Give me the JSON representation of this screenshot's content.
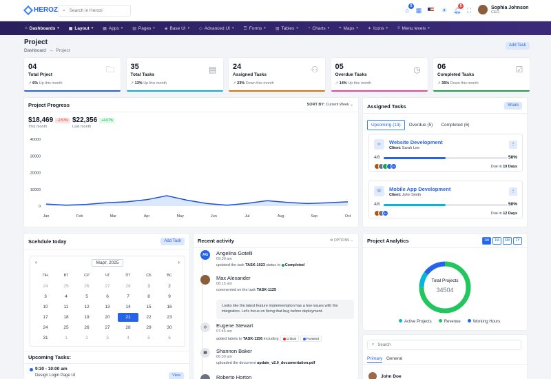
{
  "app": {
    "name": "Herozi"
  },
  "topbar": {
    "search_placeholder": "Search in Herozi",
    "cart_count": "5",
    "notif_count": "5",
    "user": {
      "name": "Sophia Johnson",
      "role": "CEO"
    }
  },
  "nav": [
    {
      "label": "Dashboards",
      "icon": "home-icon",
      "active": true
    },
    {
      "label": "Layout",
      "icon": "layout-icon",
      "active": true
    },
    {
      "label": "Apps",
      "icon": "grid-icon"
    },
    {
      "label": "Pages",
      "icon": "pages-icon"
    },
    {
      "label": "Base UI",
      "icon": "base-ui-icon"
    },
    {
      "label": "Advanced UI",
      "icon": "advanced-ui-icon"
    },
    {
      "label": "Forms",
      "icon": "forms-icon"
    },
    {
      "label": "Tables",
      "icon": "tables-icon"
    },
    {
      "label": "Charts",
      "icon": "charts-icon"
    },
    {
      "label": "Maps",
      "icon": "maps-icon"
    },
    {
      "label": "Icons",
      "icon": "icons-icon"
    },
    {
      "label": "Menu levels",
      "icon": "menu-icon"
    }
  ],
  "page": {
    "title": "Project",
    "crumb_root": "Dashboard",
    "crumb_current": "Project",
    "add_task": "Add Task"
  },
  "stats": [
    {
      "num": "04",
      "label": "Total Prject",
      "pct": "6%",
      "trend": "Up this month",
      "icon": "folder-icon",
      "color": "#2563eb"
    },
    {
      "num": "35",
      "label": "Total Tasks",
      "pct": "13%",
      "trend": "Up this month",
      "icon": "tasks-icon",
      "color": "#06b6d4"
    },
    {
      "num": "24",
      "label": "Assigned Tasks",
      "pct": "23%",
      "trend": "Down this month",
      "icon": "user-add-icon",
      "color": "#d97706"
    },
    {
      "num": "05",
      "label": "Overdue Tasks",
      "pct": "14%",
      "trend": "Up this month",
      "icon": "clock-icon",
      "color": "#ec4899"
    },
    {
      "num": "06",
      "label": "Completed Tasks",
      "pct": "35%",
      "trend": "Down this month",
      "icon": "check-icon",
      "color": "#16a34a"
    }
  ],
  "progress": {
    "title": "Project Progress",
    "sort_label": "SORT BY:",
    "sort_value": "Current Week",
    "v1": "$18,469",
    "v1_tag": "-2.57%",
    "v1_label": "This month",
    "v2": "$22,356",
    "v2_tag": "+4.67%",
    "v2_label": "Last month"
  },
  "chart_data": {
    "type": "area",
    "categories": [
      "Jan",
      "Feb",
      "Mar",
      "Apr",
      "May",
      "Jun",
      "Jul",
      "Aug",
      "Sep",
      "Oct"
    ],
    "series": [
      {
        "values": [
          1200,
          500,
          1000,
          2000,
          2500,
          3800,
          6200,
          3500,
          1500,
          500,
          1600,
          3200,
          2200,
          1500,
          2000,
          2500
        ]
      }
    ],
    "yticks": [
      "40000",
      "30000",
      "20000",
      "10000",
      "0"
    ],
    "ylim": [
      0,
      40000
    ]
  },
  "assigned": {
    "title": "Assigned Tasks",
    "share": "Share",
    "tabs": [
      "Upcoming (13)",
      "Overdue (5)",
      "Completed (6)"
    ],
    "tasks": [
      {
        "name": "Website Development",
        "client_label": "Client:",
        "client": "Sarah Lee",
        "frac": "4/8",
        "pct": "50%",
        "progress": 0.5,
        "color": "#2563eb",
        "due_label": "Due in",
        "due": "10 Days",
        "more": "8+",
        "icon": "code-icon"
      },
      {
        "name": "Mobile App Development",
        "client_label": "Client:",
        "client": "John Smith",
        "frac": "4/8",
        "pct": "50%",
        "progress": 0.5,
        "color": "#06b6d4",
        "due_label": "Due in",
        "due": "12 Days",
        "more": "8+",
        "icon": "phone-icon"
      }
    ]
  },
  "schedule": {
    "title": "Scehdule today",
    "add": "Add Task",
    "month": "Март, 2025",
    "dow": [
      "ПН",
      "ВТ",
      "СР",
      "ЧТ",
      "ПТ",
      "СБ",
      "ВС"
    ],
    "weeks": [
      [
        "24",
        "25",
        "26",
        "27",
        "28",
        "1",
        "2"
      ],
      [
        "3",
        "4",
        "5",
        "6",
        "7",
        "8",
        "9"
      ],
      [
        "10",
        "11",
        "12",
        "13",
        "14",
        "15",
        "16"
      ],
      [
        "17",
        "18",
        "19",
        "20",
        "21",
        "22",
        "23"
      ],
      [
        "24",
        "25",
        "26",
        "27",
        "28",
        "29",
        "30"
      ],
      [
        "31",
        "1",
        "2",
        "3",
        "4",
        "5",
        "6"
      ]
    ],
    "selected": "21"
  },
  "upcoming": {
    "title": "Upcoming Tasks:",
    "time": "9:30 - 10:00 am",
    "task": "Design Login Page UI",
    "view": "View"
  },
  "activity": {
    "title": "Recent activity",
    "options": "OPTIONS",
    "items": [
      {
        "initials": "AG",
        "name": "Angelina Gotelli",
        "time": "09:30 am",
        "pre": "updated the task",
        "ref": "TASK-1023",
        "mid": "status to",
        "status": "Completed"
      },
      {
        "name": "Max Alexander",
        "time": "08:15 am",
        "pre": "commented on the task",
        "ref": "TASK-1125",
        "comment": "Looks like the latest feature implementation has a few issues with the integration. Let's focus on fixing that bug before deployment."
      },
      {
        "name": "Eugene Stewart",
        "time": "07:45 am",
        "pre": "added labels to",
        "ref": "TASK-1156",
        "mid": "including",
        "label1": "Critical",
        "label2": "Frontend"
      },
      {
        "name": "Shannon Baker",
        "time": "06:30 am",
        "pre": "uploaded the document",
        "ref": "update_v2.0_documentation.pdf"
      },
      {
        "name": "Roberto Horton"
      }
    ]
  },
  "analytics": {
    "title": "Project Analytics",
    "ranges": [
      "1W",
      "1M",
      "6M",
      "1Y"
    ],
    "center_label": "Total Projects",
    "center_value": "34504",
    "legend": [
      {
        "label": "Active Projects",
        "color": "#06b6d4",
        "value": 10
      },
      {
        "label": "Revenue",
        "color": "#22c55e",
        "value": 75
      },
      {
        "label": "Working Hours",
        "color": "#2563eb",
        "value": 15
      }
    ]
  },
  "contacts": {
    "search_placeholder": "Search",
    "tabs": [
      "Primary",
      "General"
    ],
    "first": "John Doe"
  }
}
